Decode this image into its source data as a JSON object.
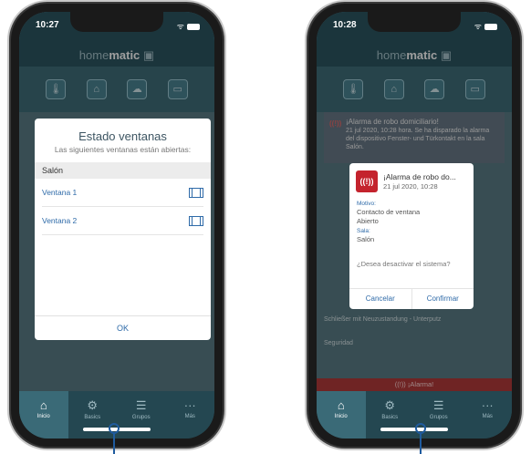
{
  "left": {
    "status_time": "10:27",
    "logo_prefix": "home",
    "logo_brand": "matic",
    "dialog": {
      "title": "Estado ventanas",
      "subtitle": "Las siguientes ventanas están abiertas:",
      "section": "Salón",
      "items": [
        {
          "label": "Ventana 1"
        },
        {
          "label": "Ventana 2"
        }
      ],
      "ok_label": "OK"
    }
  },
  "right": {
    "status_time": "10:28",
    "logo_prefix": "home",
    "logo_brand": "matic",
    "background_notification": {
      "title": "¡Alarma de robo domiciliario!",
      "body": "21 jul 2020, 10:28 hora. Se ha disparado la alarma del dispositivo Fenster- und Türkontakt en la sala Salón."
    },
    "background_rows": [
      "Schließer mit Neuzustandung - Unterputz",
      "Seguridad"
    ],
    "alarm_bar": "¡Alarma!",
    "dialog": {
      "title": "¡Alarma de robo do...",
      "date": "21 jul 2020, 10:28",
      "motive_label": "Motivo:",
      "motive_value": "Contacto de ventana",
      "motive_state": "Abierto",
      "room_label": "Sala:",
      "room_value": "Salón",
      "question": "¿Desea desactivar el sistema?",
      "cancel_label": "Cancelar",
      "confirm_label": "Confirmar"
    }
  },
  "tabs": [
    {
      "label": "Inicio",
      "icon": "home-icon"
    },
    {
      "label": "Basics",
      "icon": "gear-icon"
    },
    {
      "label": "Grupos",
      "icon": "groups-icon"
    },
    {
      "label": "Más",
      "icon": "more-icon"
    }
  ],
  "colors": {
    "app_header": "#2d5662",
    "accent": "#2e6aa8",
    "alarm_red": "#c4232d",
    "tabbar": "#244751"
  }
}
